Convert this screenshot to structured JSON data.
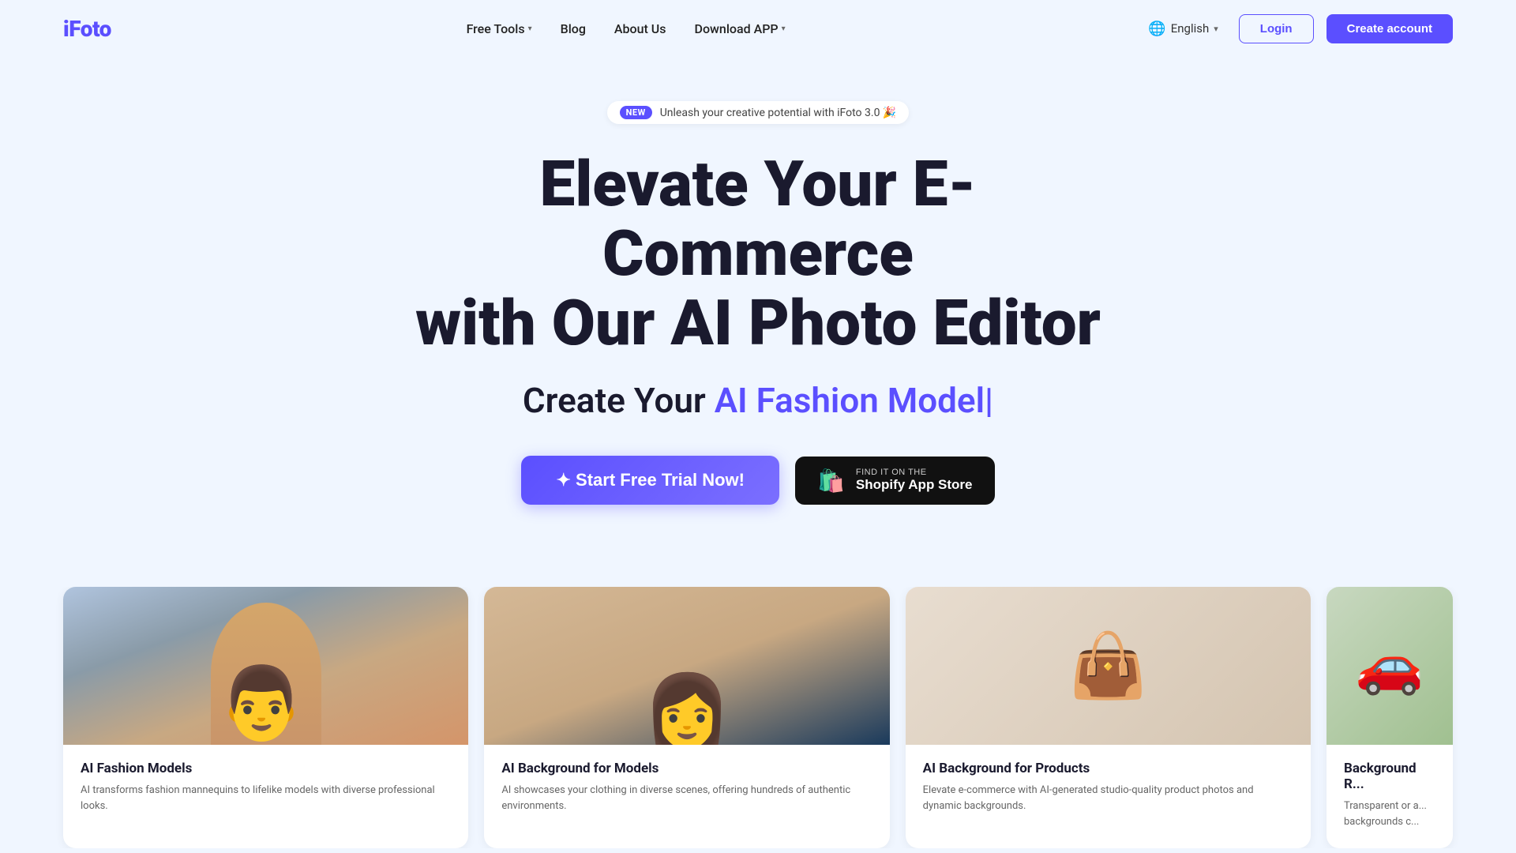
{
  "brand": {
    "logo": "iFoto",
    "logo_color": "#5b4fff"
  },
  "nav": {
    "links": [
      {
        "label": "Free Tools",
        "has_dropdown": true
      },
      {
        "label": "Blog",
        "has_dropdown": false
      },
      {
        "label": "About Us",
        "has_dropdown": false
      },
      {
        "label": "Download APP",
        "has_dropdown": true
      }
    ],
    "language": {
      "label": "English",
      "chevron": "▾"
    },
    "login_label": "Login",
    "create_label": "Create account"
  },
  "hero": {
    "badge_new": "NEW",
    "badge_text": "Unleash your creative potential with iFoto 3.0 🎉",
    "title_line1": "Elevate Your E-Commerce",
    "title_line2": "with Our AI Photo Editor",
    "subtitle_static": "Create Your ",
    "subtitle_dynamic": "AI Fashion Model",
    "subtitle_cursor": "|",
    "trial_button": "✦ Start Free Trial Now!",
    "shopify_top": "FIND IT ON THE",
    "shopify_bottom": "Shopify App Store"
  },
  "cards": [
    {
      "id": "fashion",
      "title": "AI Fashion Models",
      "desc": "AI transforms fashion mannequins to lifelike models with diverse professional looks.",
      "emoji": "👨"
    },
    {
      "id": "bg-model",
      "title": "AI Background for Models",
      "desc": "AI showcases your clothing in diverse scenes, offering hundreds of authentic environments.",
      "emoji": "👩"
    },
    {
      "id": "bg-product",
      "title": "AI Background for Products",
      "desc": "Elevate e-commerce with AI-generated studio-quality product photos and dynamic backgrounds.",
      "emoji": "👜"
    },
    {
      "id": "bg-car",
      "title": "Background R...",
      "desc": "Transparent or a... backgrounds c...",
      "emoji": "🚗"
    }
  ]
}
